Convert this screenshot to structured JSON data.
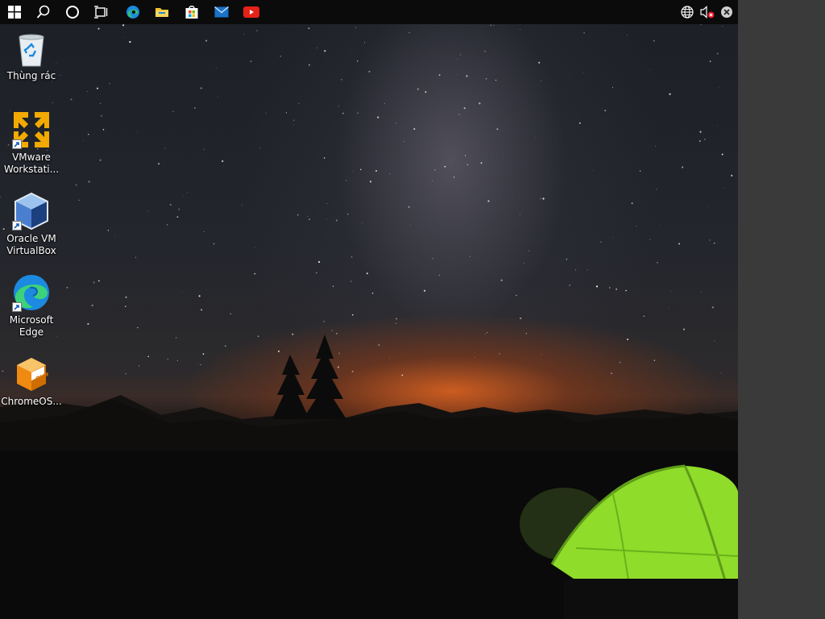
{
  "taskbar": {
    "buttons": [
      {
        "name": "start-button",
        "icon": "windows-logo-icon"
      },
      {
        "name": "search-button",
        "icon": "search-icon"
      },
      {
        "name": "cortana-button",
        "icon": "circle-icon"
      },
      {
        "name": "task-view-button",
        "icon": "task-view-icon"
      },
      {
        "name": "edge-taskbar-button",
        "icon": "edge-icon"
      },
      {
        "name": "file-explorer-button",
        "icon": "folder-icon"
      },
      {
        "name": "store-button",
        "icon": "store-icon"
      },
      {
        "name": "mail-button",
        "icon": "mail-icon"
      },
      {
        "name": "youtube-button",
        "icon": "youtube-icon"
      }
    ],
    "tray": [
      {
        "name": "network-icon"
      },
      {
        "name": "volume-muted-icon"
      },
      {
        "name": "close-circle-icon"
      }
    ]
  },
  "desktop": {
    "icons": [
      {
        "label": "Thùng rác",
        "icon": "recycle-bin-icon"
      },
      {
        "label": "VMware Workstati...",
        "icon": "vmware-icon"
      },
      {
        "label": "Oracle VM VirtualBox",
        "icon": "virtualbox-icon"
      },
      {
        "label": "Microsoft Edge",
        "icon": "edge-icon"
      },
      {
        "label": "ChromeOS...",
        "icon": "ova-package-icon"
      }
    ]
  },
  "colors": {
    "taskbar": "#0b0b0b",
    "tent": "#8fdc2a",
    "sunset": "#e0641e",
    "side_panel": "#3a3a3a"
  }
}
